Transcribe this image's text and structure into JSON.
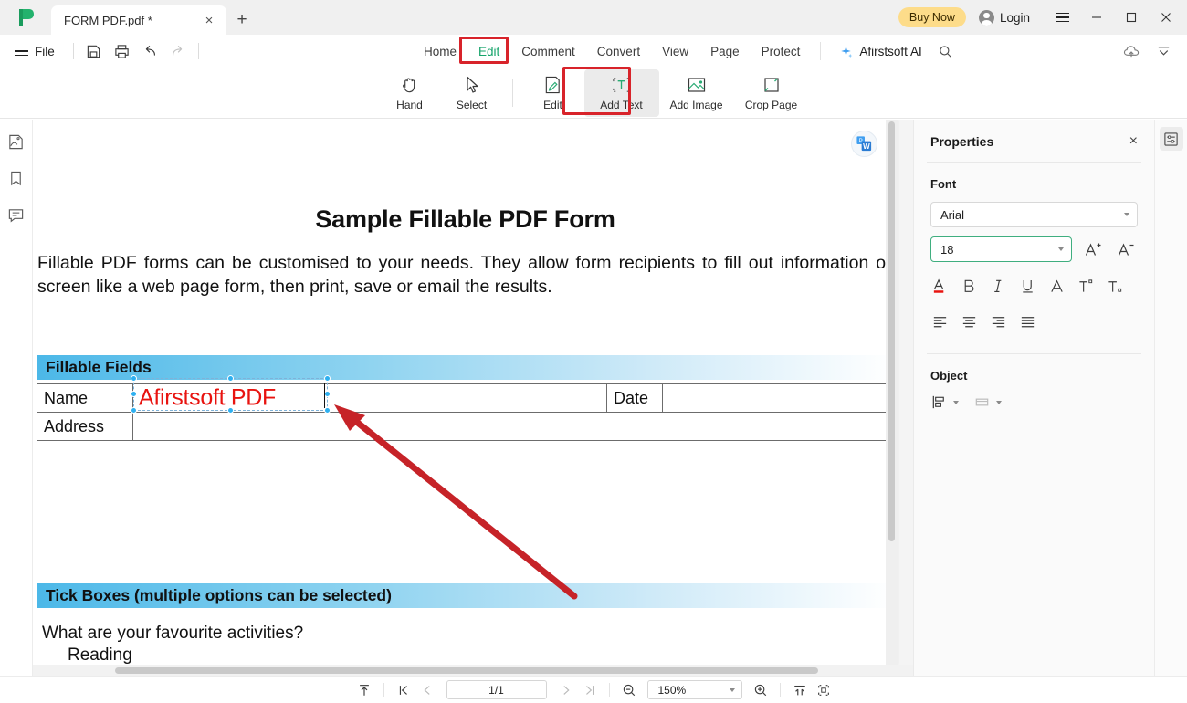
{
  "window": {
    "tab_title": "FORM PDF.pdf *",
    "new_tab_label": "+",
    "close_tab_label": "×",
    "buy_now": "Buy Now",
    "login": "Login",
    "minimize": "—",
    "maximize": "□",
    "close": "×",
    "menu_label": "☰"
  },
  "menubar": {
    "file_label": "File",
    "tabs": [
      {
        "label": "Home",
        "active": false
      },
      {
        "label": "Edit",
        "active": true
      },
      {
        "label": "Comment",
        "active": false
      },
      {
        "label": "Convert",
        "active": false
      },
      {
        "label": "View",
        "active": false
      },
      {
        "label": "Page",
        "active": false
      },
      {
        "label": "Protect",
        "active": false
      }
    ],
    "ai_label": "Afirstsoft AI",
    "quick_icons": [
      "save-icon",
      "print-icon",
      "undo-icon",
      "redo-icon"
    ],
    "right_icons": [
      "search-icon",
      "cloud-upload-icon",
      "collapse-ribbon-icon"
    ]
  },
  "ribbon": {
    "buttons": [
      {
        "label": "Hand",
        "icon": "hand-icon",
        "selected": false
      },
      {
        "label": "Select",
        "icon": "cursor-icon",
        "selected": false
      },
      {
        "label": "Edit",
        "icon": "edit-page-icon",
        "selected": false
      },
      {
        "label": "Add Text",
        "icon": "add-text-icon",
        "selected": true
      },
      {
        "label": "Add Image",
        "icon": "add-image-icon",
        "selected": false
      },
      {
        "label": "Crop Page",
        "icon": "crop-page-icon",
        "selected": false
      }
    ]
  },
  "left_rail": {
    "items": [
      "thumbnail-icon",
      "bookmark-icon",
      "comment-icon"
    ]
  },
  "document": {
    "title": "Sample Fillable PDF Form",
    "paragraph": "Fillable PDF forms can be customised to your needs. They allow form recipients to fill out information on screen like a web page form, then print, save or email the results.",
    "band_fillable": "Fillable Fields",
    "band_tickboxes": "Tick Boxes (multiple options can be selected)",
    "row_name_label": "Name",
    "row_name_value": "Afirstsoft PDF",
    "row_date_label": "Date",
    "row_date_value": "",
    "row_address_label": "Address",
    "row_address_value": "",
    "question": "What are your favourite activities?",
    "option_1": "Reading",
    "convert_badge": "word-convert-icon",
    "selected_text_color": "#e8130f"
  },
  "properties": {
    "title": "Properties",
    "close_label": "×",
    "font_section": "Font",
    "font_family": "Arial",
    "font_size": "18",
    "increase_font": "A⁺",
    "decrease_font": "A⁻",
    "format_buttons": [
      {
        "name": "font-color-icon",
        "glyph": "A"
      },
      {
        "name": "bold-icon",
        "glyph": "B"
      },
      {
        "name": "italic-icon",
        "glyph": "I"
      },
      {
        "name": "underline-icon",
        "glyph": "U"
      },
      {
        "name": "strikethrough-icon",
        "glyph": "A"
      },
      {
        "name": "superscript-icon",
        "glyph": "T"
      },
      {
        "name": "subscript-icon",
        "glyph": "T"
      }
    ],
    "align_buttons": [
      "align-left-icon",
      "align-center-icon",
      "align-right-icon",
      "align-justify-icon"
    ],
    "object_section": "Object",
    "object_buttons": [
      "align-object-icon",
      "arrange-object-icon"
    ],
    "accent_color": "#3fae7f",
    "font_color_swatch": "#e8130f"
  },
  "status_bar": {
    "page_value": "1/1",
    "zoom_value": "150%",
    "icons": [
      "fit-top-icon",
      "first-page-icon",
      "prev-page-icon",
      "next-page-icon",
      "last-page-icon",
      "zoom-out-icon",
      "zoom-in-icon",
      "fit-width-icon",
      "fit-page-icon"
    ]
  },
  "annotations": {
    "box_edit_tab": "red-highlight-box",
    "box_add_text": "red-highlight-box",
    "arrow": "red-arrow-pointer",
    "color": "#d8232a"
  }
}
